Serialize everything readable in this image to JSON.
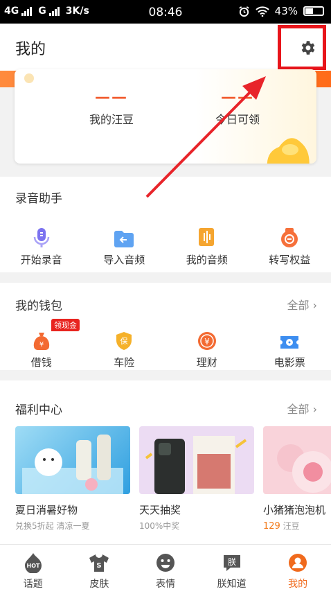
{
  "status_bar": {
    "network1": "4G",
    "network2": "G",
    "speed": "3K/s",
    "time": "08:46",
    "battery": "43%"
  },
  "header": {
    "title": "我的"
  },
  "points": {
    "items": [
      {
        "value": "——",
        "label": "我的汪豆"
      },
      {
        "value": "——",
        "label": "今日可领"
      }
    ]
  },
  "recording": {
    "title": "录音助手",
    "items": [
      {
        "label": "开始录音",
        "icon": "mic-icon"
      },
      {
        "label": "导入音频",
        "icon": "import-folder-icon"
      },
      {
        "label": "我的音频",
        "icon": "audio-file-icon"
      },
      {
        "label": "转写权益",
        "icon": "transcribe-icon"
      }
    ]
  },
  "wallet": {
    "title": "我的钱包",
    "more": "全部",
    "badge": "领现金",
    "items": [
      {
        "label": "借钱",
        "icon": "money-bag-icon"
      },
      {
        "label": "车险",
        "icon": "shield-icon",
        "glyph": "保"
      },
      {
        "label": "理财",
        "icon": "yen-coin-icon",
        "glyph": "¥"
      },
      {
        "label": "电影票",
        "icon": "movie-ticket-icon"
      }
    ]
  },
  "welfare": {
    "title": "福利中心",
    "more": "全部",
    "cards": [
      {
        "title": "夏日消暑好物",
        "subtitle": "兑换5折起 清凉一夏"
      },
      {
        "title": "天天抽奖",
        "subtitle": "100%中奖"
      },
      {
        "title": "小猪猪泡泡机",
        "points": "129",
        "points_unit": " 汪豆"
      }
    ]
  },
  "tabbar": {
    "items": [
      {
        "label": "话题",
        "glyph": "HOT"
      },
      {
        "label": "皮肤",
        "glyph": "S"
      },
      {
        "label": "表情",
        "glyph": ""
      },
      {
        "label": "朕知道",
        "glyph": "朕"
      },
      {
        "label": "我的",
        "glyph": ""
      }
    ]
  },
  "colors": {
    "accent": "#f06a1d",
    "highlight": "#e8151b"
  }
}
